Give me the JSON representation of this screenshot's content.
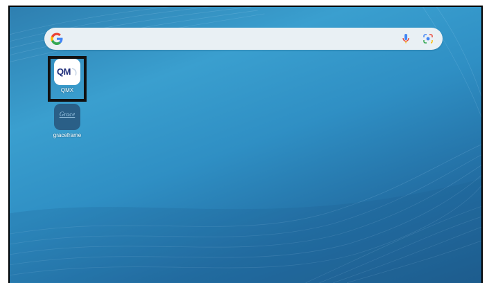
{
  "search_bar": {
    "logo": "google-g-icon",
    "mic_icon": "mic-icon",
    "lens_icon": "lens-icon"
  },
  "apps": [
    {
      "label": "QMX",
      "icon_text": "QM",
      "icon": "qmx-app-icon",
      "highlighted": true
    },
    {
      "label": "graceframe",
      "icon_text": "Grace",
      "icon": "graceframe-app-icon",
      "highlighted": false
    }
  ],
  "colors": {
    "wallpaper_primary": "#2f8fc4",
    "wallpaper_dark": "#1e5e8f",
    "search_bar_bg": "#e9f0f4",
    "google_blue": "#4285F4",
    "google_red": "#EA4335",
    "google_yellow": "#FBBC05",
    "google_green": "#34A853",
    "qmx_text": "#1f2d7a",
    "graceframe_bg": "#2a5f87"
  }
}
